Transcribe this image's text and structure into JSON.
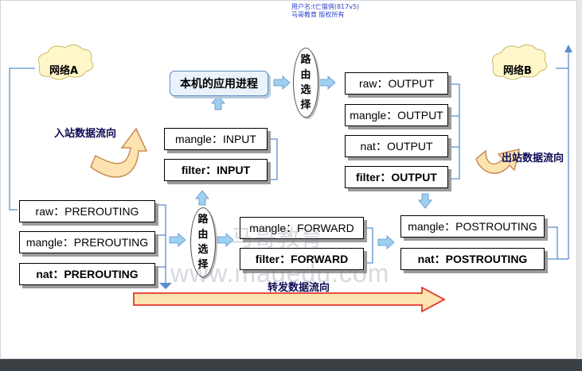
{
  "watermark": {
    "top_line1": "用户名:t亡猫俏(817v5)",
    "top_line2": "马哥教育 版权所有",
    "center_cn": "马哥教育",
    "center_url": "www.magedu.com"
  },
  "networks": {
    "a": "网络A",
    "b": "网络B"
  },
  "flows": {
    "inbound": "入站数据流向",
    "outbound": "出站数据流向",
    "forward": "转发数据流向"
  },
  "routing": {
    "label": "路由选择",
    "label_lines": [
      "路",
      "由",
      "选",
      "择"
    ]
  },
  "app": {
    "label": "本机的应用进程"
  },
  "chains": {
    "prerouting": [
      "raw：PREROUTING",
      "mangle：PREROUTING",
      "nat：PREROUTING"
    ],
    "input": [
      "mangle：INPUT",
      "filter：INPUT"
    ],
    "forward": [
      "mangle：FORWARD",
      "filter：FORWARD"
    ],
    "output": [
      "raw：OUTPUT",
      "mangle：OUTPUT",
      "nat：OUTPUT",
      "filter：OUTPUT"
    ],
    "postrouting": [
      "mangle：POSTROUTING",
      "nat：POSTROUTING"
    ]
  },
  "colors": {
    "line": "#5b8ed0",
    "arrow": "#9fd0ee",
    "big_arrow_fill": "#fde3b0",
    "big_arrow_stroke": "#e1372c",
    "annotation": "#e0201b",
    "cloud": "#fff7c9"
  }
}
